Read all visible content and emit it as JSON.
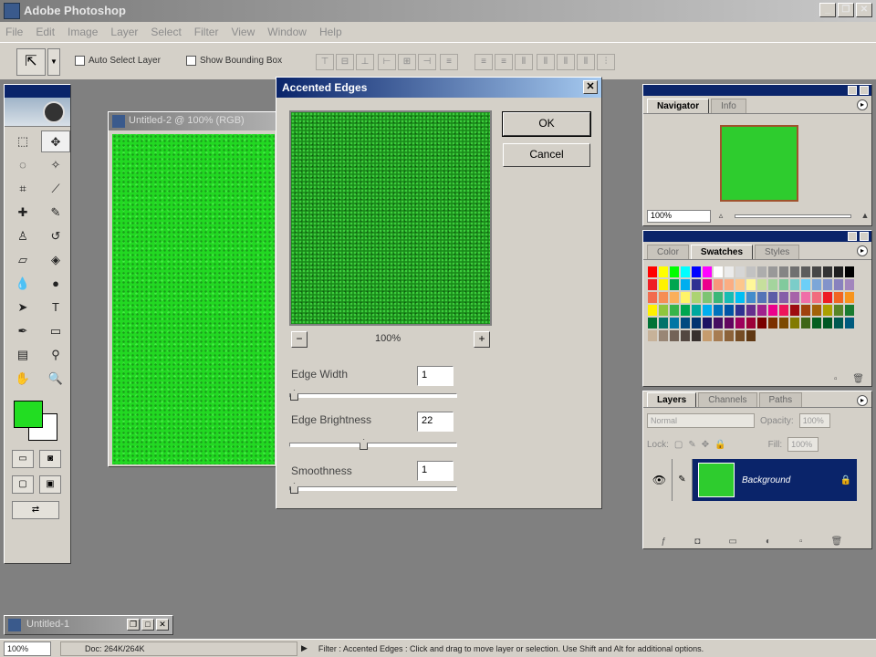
{
  "app": {
    "title": "Adobe Photoshop"
  },
  "window_controls": {
    "minimize": "_",
    "restore": "❐",
    "close": "✕"
  },
  "menu": [
    "File",
    "Edit",
    "Image",
    "Layer",
    "Select",
    "Filter",
    "View",
    "Window",
    "Help"
  ],
  "options_bar": {
    "auto_select_label": "Auto Select Layer",
    "show_bounding_label": "Show Bounding Box"
  },
  "document": {
    "title": "Untitled-2 @ 100% (RGB)",
    "minimized_title": "Untitled-1"
  },
  "dialog": {
    "title": "Accented Edges",
    "ok_label": "OK",
    "cancel_label": "Cancel",
    "zoom_level": "100%",
    "zoom_out": "−",
    "zoom_in": "+",
    "params": [
      {
        "label": "Edge Width",
        "value": "1",
        "slider_fraction": 0.0
      },
      {
        "label": "Edge Brightness",
        "value": "22",
        "slider_fraction": 0.44
      },
      {
        "label": "Smoothness",
        "value": "1",
        "slider_fraction": 0.0
      }
    ]
  },
  "navigator_palette": {
    "tabs": [
      "Navigator",
      "Info"
    ],
    "zoom": "100%"
  },
  "swatches_palette": {
    "tabs": [
      "Color",
      "Swatches",
      "Styles"
    ]
  },
  "layers_palette": {
    "tabs": [
      "Layers",
      "Channels",
      "Paths"
    ],
    "blend_mode": "Normal",
    "opacity_label": "Opacity:",
    "opacity_value": "100%",
    "lock_label": "Lock:",
    "fill_label": "Fill:",
    "fill_value": "100%",
    "layer_name": "Background"
  },
  "status_bar": {
    "zoom": "100%",
    "doc_info": "Doc: 264K/264K",
    "message": "Filter : Accented Edges : Click and drag to move layer or selection. Use Shift and Alt for additional options."
  },
  "colors": {
    "foreground": "#22dd22",
    "background": "#ffffff",
    "canvas": "#22d822"
  },
  "swatch_colors": [
    [
      "#ff0000",
      "#ffff00",
      "#00ff00",
      "#00ffff",
      "#0000ff",
      "#ff00ff",
      "#ffffff",
      "#ebebeb",
      "#d6d6d6",
      "#c2c2c2",
      "#adadad",
      "#999999",
      "#858585",
      "#707070",
      "#5c5c5c",
      "#474747",
      "#333333",
      "#1f1f1f",
      "#000000"
    ],
    [
      "#ee1d24",
      "#fff200",
      "#00a650",
      "#00aeef",
      "#2e3192",
      "#ec008c",
      "#f7977a",
      "#fbad82",
      "#fdc68c",
      "#fff799",
      "#c6df9c",
      "#a4d49d",
      "#81ca9d",
      "#7bcdc9",
      "#6ccff7",
      "#7ca6d8",
      "#8293ca",
      "#8881be",
      "#a286bd"
    ],
    [
      "#f26c4f",
      "#f68e55",
      "#fbaf5a",
      "#fff467",
      "#acd372",
      "#7dc473",
      "#39b778",
      "#16bcb4",
      "#00bff3",
      "#438ccb",
      "#5573b7",
      "#5e5ca7",
      "#855fa8",
      "#a763a9",
      "#ef6ea8",
      "#f16d7e",
      "#ee1d24",
      "#f16522",
      "#f7941d"
    ],
    [
      "#fff100",
      "#8fc63d",
      "#37b44a",
      "#00a650",
      "#00a99e",
      "#00aeef",
      "#0072bc",
      "#0054a5",
      "#2f3192",
      "#652f8e",
      "#a0228d",
      "#ec008c",
      "#ed145a",
      "#9e0b0f",
      "#a0410d",
      "#a36209",
      "#aba000",
      "#588528",
      "#197b30"
    ],
    [
      "#007236",
      "#00736a",
      "#0076a4",
      "#004a80",
      "#003370",
      "#1d1363",
      "#450e61",
      "#62055f",
      "#9e005c",
      "#9d0039",
      "#790000",
      "#7b3000",
      "#7c4900",
      "#827a00",
      "#3e6617",
      "#045f20",
      "#005824",
      "#005951",
      "#005b7e"
    ],
    [
      "#c7b299",
      "#998675",
      "#736357",
      "#534741",
      "#37302d",
      "#c69c6e",
      "#a77c52",
      "#8c6239",
      "#754c24",
      "#603813",
      "#d4d0c8",
      "#d4d0c8",
      "#d4d0c8",
      "#d4d0c8",
      "#d4d0c8",
      "#d4d0c8",
      "#d4d0c8",
      "#d4d0c8",
      "#d4d0c8"
    ]
  ],
  "icons": {
    "move_tool": "⇱",
    "eye": "👁",
    "brush": "✎",
    "lock": "🔒",
    "status_arrow": "▶"
  }
}
